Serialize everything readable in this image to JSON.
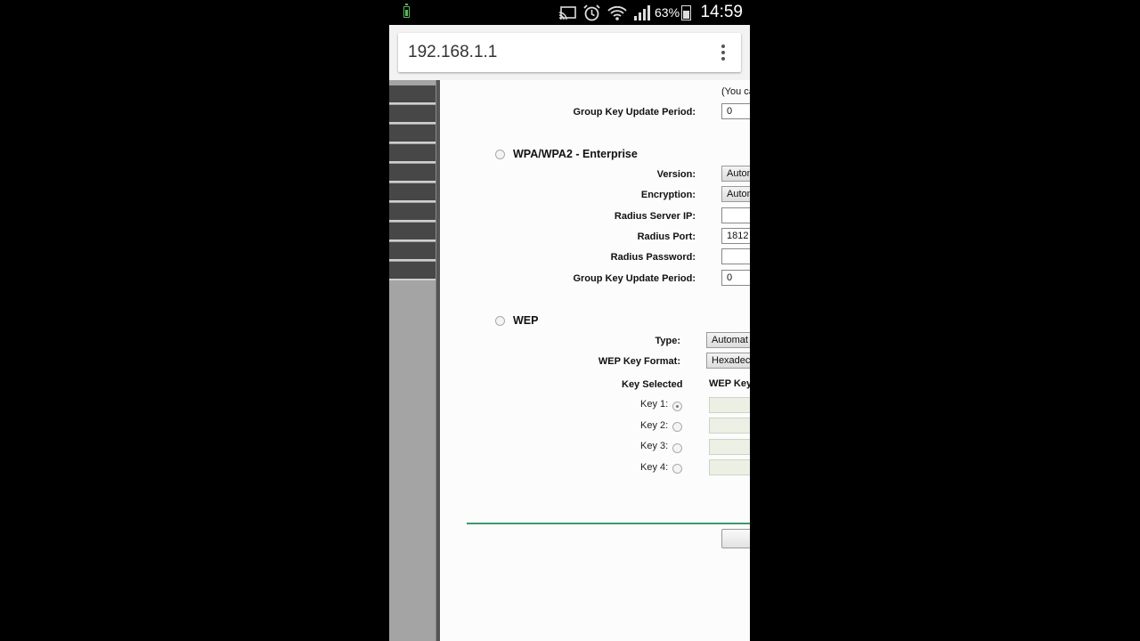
{
  "status_bar": {
    "battery_percent": "63%",
    "time": "14:59",
    "icons": [
      "battery-saver-icon",
      "cast-icon",
      "alarm-icon",
      "wifi-icon",
      "signal-icon",
      "battery-icon"
    ]
  },
  "browser": {
    "url": "192.168.1.1",
    "menu_icon": "more-vert-icon"
  },
  "wpa_personal_tail": {
    "note_text": "(You ca",
    "group_key_label": "Group Key Update Period:",
    "group_key_value": "0"
  },
  "wpa_enterprise": {
    "title": "WPA/WPA2 - Enterprise",
    "version_label": "Version:",
    "version_value": "Autom",
    "encryption_label": "Encryption:",
    "encryption_value": "Autom",
    "radius_ip_label": "Radius Server IP:",
    "radius_ip_value": "",
    "radius_port_label": "Radius Port:",
    "radius_port_value": "1812",
    "radius_password_label": "Radius Password:",
    "radius_password_value": "",
    "group_key_label": "Group Key Update Period:",
    "group_key_value": "0"
  },
  "wep": {
    "title": "WEP",
    "type_label": "Type:",
    "type_value": "Automat",
    "format_label": "WEP Key Format:",
    "format_value": "Hexadec",
    "key_selected_header": "Key Selected",
    "wep_key_header": "WEP Key",
    "keys": [
      {
        "label": "Key 1:",
        "selected": true
      },
      {
        "label": "Key 2:",
        "selected": false
      },
      {
        "label": "Key 3:",
        "selected": false
      },
      {
        "label": "Key 4:",
        "selected": false
      }
    ]
  },
  "colors": {
    "sidebar_dark": "#474747",
    "sidebar_light": "#a4a4a4",
    "separator_green": "#3a9a6e",
    "status_green": "#5cb85c"
  }
}
